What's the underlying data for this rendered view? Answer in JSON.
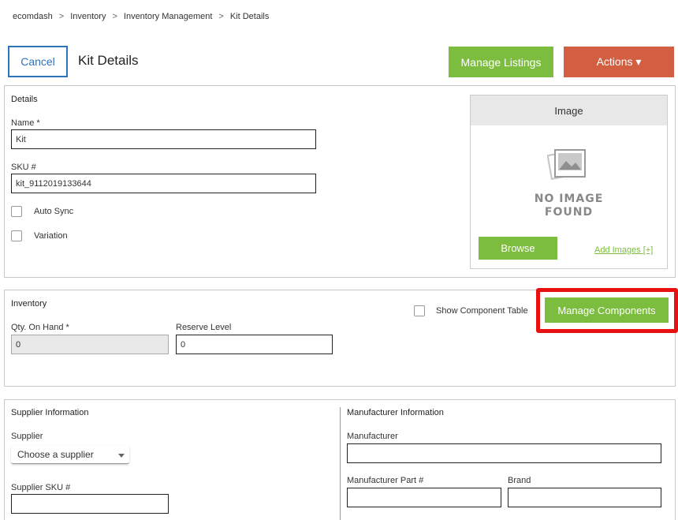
{
  "breadcrumb": [
    "ecomdash",
    "Inventory",
    "Inventory Management",
    "Kit Details"
  ],
  "header": {
    "cancel_label": "Cancel",
    "title": "Kit Details",
    "manage_listings_label": "Manage Listings",
    "actions_label": "Actions ▾"
  },
  "details": {
    "section_title": "Details",
    "name_label": "Name *",
    "name_value": "Kit",
    "sku_label": "SKU #",
    "sku_value": "kit_9112019133644",
    "auto_sync_label": "Auto Sync",
    "variation_label": "Variation"
  },
  "image": {
    "header": "Image",
    "no_image_line1": "NO IMAGE",
    "no_image_line2": "FOUND",
    "browse_label": "Browse",
    "add_images_label": "Add Images [+]"
  },
  "inventory": {
    "section_title": "Inventory",
    "show_component_table_label": "Show Component Table",
    "manage_components_label": "Manage Components",
    "qty_label": "Qty. On Hand *",
    "qty_value": "0",
    "reserve_label": "Reserve Level",
    "reserve_value": "0"
  },
  "supplier": {
    "section_title": "Supplier Information",
    "supplier_label": "Supplier",
    "supplier_selected": "Choose a supplier",
    "supplier_sku_label": "Supplier SKU #"
  },
  "manufacturer": {
    "section_title": "Manufacturer Information",
    "manufacturer_label": "Manufacturer",
    "part_label": "Manufacturer Part #",
    "brand_label": "Brand"
  },
  "colors": {
    "accent_green": "#7cbc3f",
    "accent_orange": "#d35f42",
    "link_blue": "#2f73b8",
    "highlight_red": "#e81010"
  }
}
